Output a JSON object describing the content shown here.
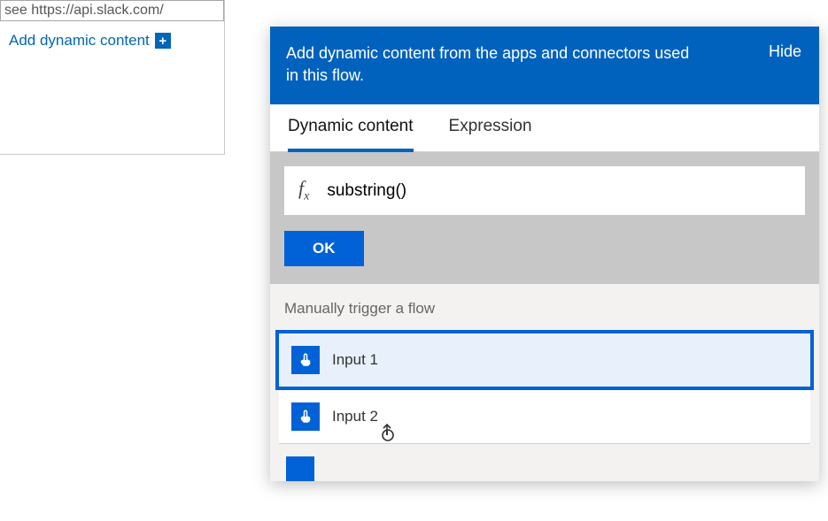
{
  "left": {
    "url_hint": "see https://api.slack.com/",
    "add_dynamic_label": "Add dynamic content"
  },
  "popover": {
    "header_text": "Add dynamic content from the apps and connectors used in this flow.",
    "hide_label": "Hide",
    "tabs": {
      "dynamic": "Dynamic content",
      "expression": "Expression"
    },
    "fx": {
      "expression": "substring()"
    },
    "ok_label": "OK",
    "section_title": "Manually trigger a flow",
    "items": [
      {
        "label": "Input 1"
      },
      {
        "label": "Input 2"
      }
    ]
  }
}
